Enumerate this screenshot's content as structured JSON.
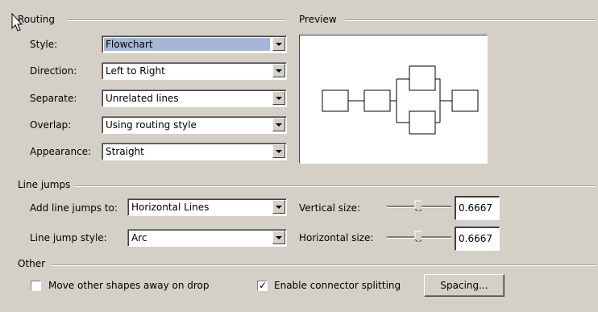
{
  "routing": {
    "title": "Routing",
    "rows": [
      {
        "label": "Style:",
        "value": "Flowchart",
        "selected": true
      },
      {
        "label": "Direction:",
        "value": "Left to Right",
        "selected": false
      },
      {
        "label": "Separate:",
        "value": "Unrelated lines",
        "selected": false
      },
      {
        "label": "Overlap:",
        "value": "Using routing style",
        "selected": false
      },
      {
        "label": "Appearance:",
        "value": "Straight",
        "selected": false
      }
    ]
  },
  "preview": {
    "title": "Preview"
  },
  "line_jumps": {
    "title": "Line jumps",
    "add_label": "Add line jumps to:",
    "add_value": "Horizontal Lines",
    "style_label": "Line jump style:",
    "style_value": "Arc",
    "vertical_label": "Vertical size:",
    "vertical_value": "0.6667",
    "horizontal_label": "Horizontal size:",
    "horizontal_value": "0.6667"
  },
  "other": {
    "title": "Other",
    "move_label": "Move other shapes away on drop",
    "move_checked": false,
    "split_label": "Enable connector splitting",
    "split_checked": true,
    "spacing_label": "Spacing..."
  },
  "colors": {
    "background": "#d4d0c8",
    "selection": "#a6b6d8"
  },
  "icons": {
    "cursor": "arrow-cursor-icon",
    "dropdown": "chevron-down-icon",
    "check": "checkmark-icon"
  }
}
